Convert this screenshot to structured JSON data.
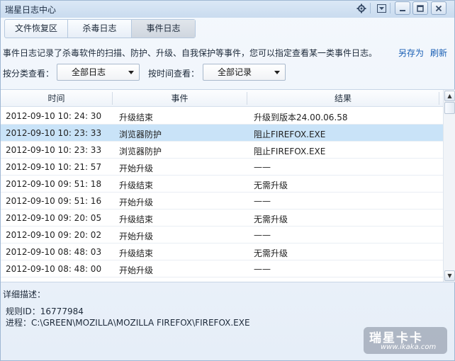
{
  "window": {
    "title": "瑞星日志中心",
    "buttons": [
      "gear-icon",
      "menu-icon",
      "minimize-icon",
      "maximize-icon",
      "close-icon"
    ]
  },
  "tabs": [
    {
      "label": "文件恢复区",
      "active": false
    },
    {
      "label": "杀毒日志",
      "active": false
    },
    {
      "label": "事件日志",
      "active": true
    }
  ],
  "toolbar": {
    "description": "事件日志记录了杀毒软件的扫描、防护、升级、自我保护等事件，您可以指定查看某一类事件日志。",
    "save_as": "另存为",
    "refresh": "刷新"
  },
  "filters": {
    "category_label": "按分类查看：",
    "category_value": "全部日志",
    "time_label": "按时间查看：",
    "time_value": "全部记录"
  },
  "table": {
    "headers": [
      "时间",
      "事件",
      "结果"
    ],
    "rows": [
      {
        "time": "2012-09-10 10: 24: 30",
        "event": "升级结束",
        "result": "升级到版本24.00.06.58",
        "selected": false
      },
      {
        "time": "2012-09-10 10: 23: 33",
        "event": "浏览器防护",
        "result": "阻止FIREFOX.EXE",
        "selected": true
      },
      {
        "time": "2012-09-10 10: 23: 33",
        "event": "浏览器防护",
        "result": "阻止FIREFOX.EXE",
        "selected": false
      },
      {
        "time": "2012-09-10 10: 21: 57",
        "event": "开始升级",
        "result": "——",
        "selected": false
      },
      {
        "time": "2012-09-10 09: 51: 18",
        "event": "升级结束",
        "result": "无需升级",
        "selected": false
      },
      {
        "time": "2012-09-10 09: 51: 16",
        "event": "开始升级",
        "result": "——",
        "selected": false
      },
      {
        "time": "2012-09-10 09: 20: 05",
        "event": "升级结束",
        "result": "无需升级",
        "selected": false
      },
      {
        "time": "2012-09-10 09: 20: 02",
        "event": "开始升级",
        "result": "——",
        "selected": false
      },
      {
        "time": "2012-09-10 08: 48: 03",
        "event": "升级结束",
        "result": "无需升级",
        "selected": false
      },
      {
        "time": "2012-09-10 08: 48: 00",
        "event": "开始升级",
        "result": "——",
        "selected": false
      }
    ]
  },
  "detail": {
    "title": "详细描述：",
    "rule_id": "规则ID：16777984",
    "process": "进程：C:\\GREEN\\MOZILLA\\MOZILLA FIREFOX\\FIREFOX.EXE"
  },
  "watermark": {
    "logo": "瑞星卡卡",
    "url": "www.ikaka.com"
  },
  "colors": {
    "selected_row": "#c9e3f8",
    "link": "#1a5fb4",
    "titlebar": "#c9dbef"
  }
}
